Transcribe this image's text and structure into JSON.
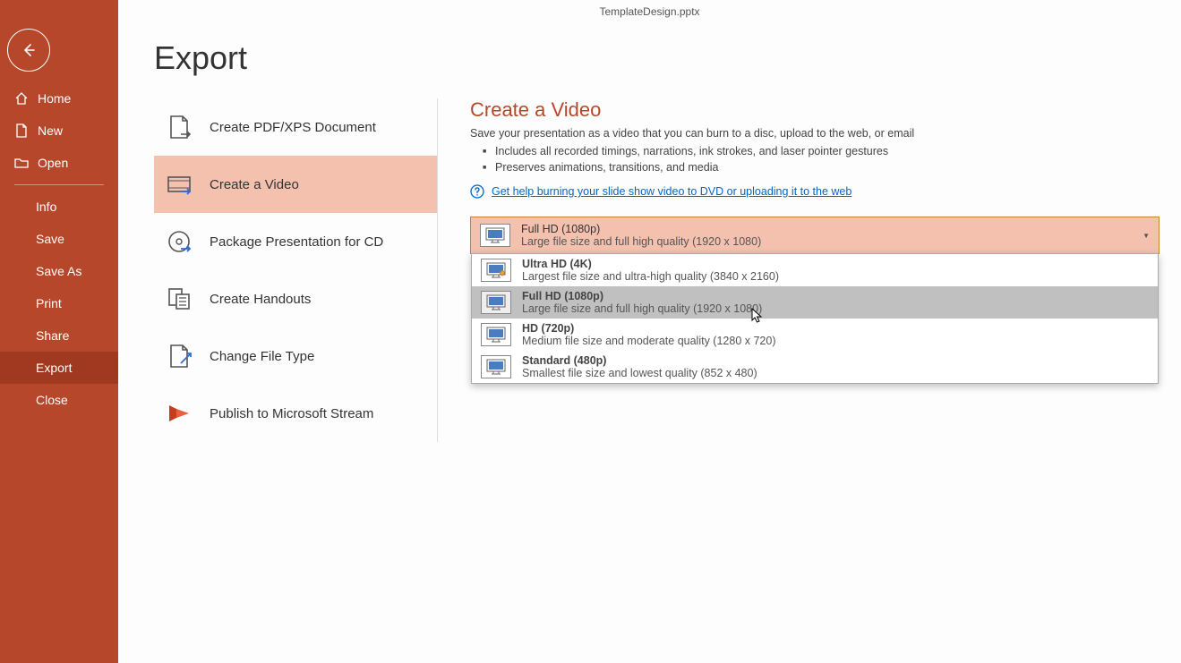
{
  "titlebar": {
    "filename": "TemplateDesign.pptx"
  },
  "sidebar": {
    "items": [
      {
        "label": "Home",
        "icon": "home"
      },
      {
        "label": "New",
        "icon": "new"
      },
      {
        "label": "Open",
        "icon": "open"
      },
      {
        "label": "Info"
      },
      {
        "label": "Save"
      },
      {
        "label": "Save As"
      },
      {
        "label": "Print"
      },
      {
        "label": "Share"
      },
      {
        "label": "Export",
        "active": true
      },
      {
        "label": "Close"
      }
    ]
  },
  "page_title": "Export",
  "export_options": [
    {
      "label": "Create PDF/XPS Document"
    },
    {
      "label": "Create a Video",
      "active": true
    },
    {
      "label": "Package Presentation for CD"
    },
    {
      "label": "Create Handouts"
    },
    {
      "label": "Change File Type"
    },
    {
      "label": "Publish to Microsoft Stream"
    }
  ],
  "detail": {
    "title": "Create a Video",
    "desc": "Save your presentation as a video that you can burn to a disc, upload to the web, or email",
    "bullets": [
      "Includes all recorded timings, narrations, ink strokes, and laser pointer gestures",
      "Preserves animations, transitions, and media"
    ],
    "help_link": "Get help burning your slide show video to DVD or uploading it to the web"
  },
  "quality_selected": {
    "title": "Full HD (1080p)",
    "sub": "Large file size and full high quality (1920 x 1080)"
  },
  "quality_options": [
    {
      "title": "Ultra HD (4K)",
      "sub": "Largest file size and ultra-high quality (3840 x 2160)"
    },
    {
      "title": "Full HD (1080p)",
      "sub": "Large file size and full high quality (1920 x 1080)",
      "hovered": true
    },
    {
      "title": "HD (720p)",
      "sub": "Medium file size and moderate quality (1280 x 720)"
    },
    {
      "title": "Standard (480p)",
      "sub": "Smallest file size and lowest quality (852 x 480)"
    }
  ]
}
